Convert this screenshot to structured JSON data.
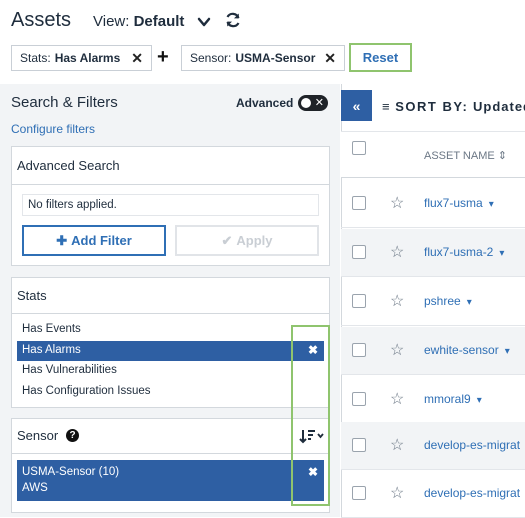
{
  "header": {
    "title": "Assets",
    "view_label": "View:",
    "view_value": "Default"
  },
  "chips": [
    {
      "key": "Stats:",
      "value": "Has Alarms"
    },
    {
      "key": "Sensor:",
      "value": "USMA-Sensor"
    }
  ],
  "reset_label": "Reset",
  "left": {
    "title": "Search & Filters",
    "advanced_label": "Advanced",
    "configure_link": "Configure filters",
    "advanced_search": {
      "title": "Advanced Search",
      "empty_text": "No filters applied.",
      "add_filter_label": "Add Filter",
      "apply_label": "Apply"
    },
    "stats": {
      "title": "Stats",
      "options": [
        "Has Events",
        "Has Alarms",
        "Has Vulnerabilities",
        "Has Configuration Issues"
      ]
    },
    "sensor": {
      "title": "Sensor",
      "selected_line1": "USMA-Sensor (10)",
      "selected_line2": "AWS"
    }
  },
  "table": {
    "sort_by_label": "SORT BY:",
    "sort_by_value": "Updated",
    "column_asset_name": "ASSET NAME",
    "rows": [
      "flux7-usma",
      "flux7-usma-2",
      "pshree",
      "ewhite-sensor",
      "mmoral9",
      "develop-es-migrat",
      "develop-es-migrat"
    ]
  },
  "colors": {
    "accent": "#2e5fa3",
    "link": "#2f6fb5",
    "highlight": "#8fc46e"
  }
}
